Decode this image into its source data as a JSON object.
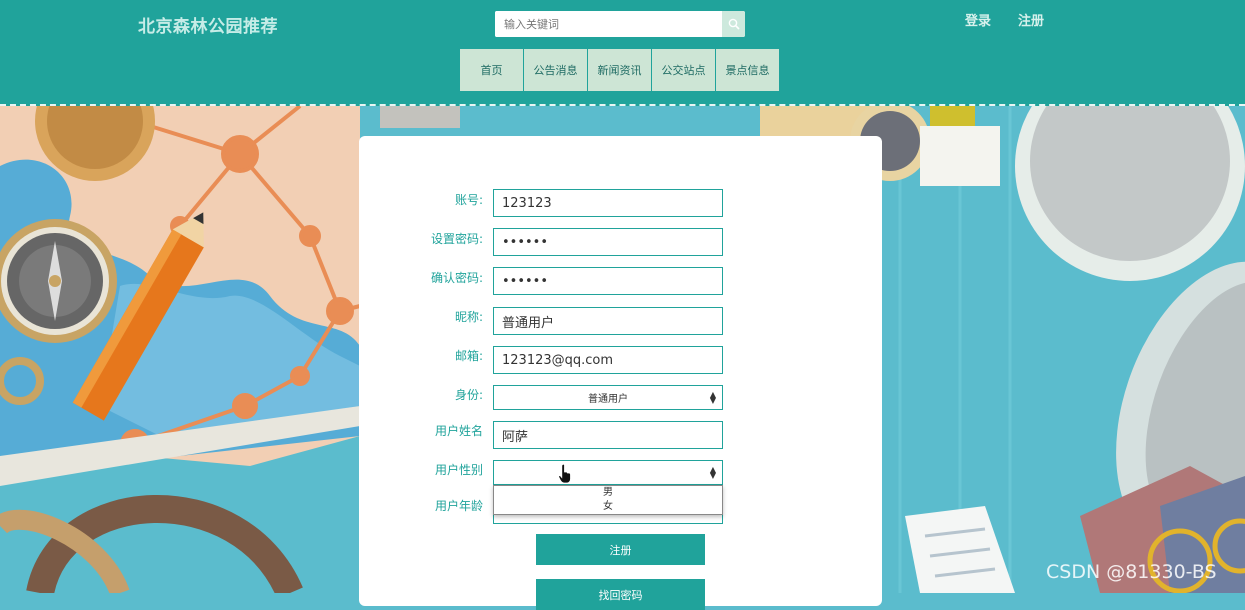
{
  "header": {
    "site_title": "北京森林公园推荐",
    "search": {
      "placeholder": "输入关键词",
      "value": ""
    },
    "login_label": "登录",
    "register_label": "注册",
    "nav": [
      {
        "label": "首页"
      },
      {
        "label": "公告消息"
      },
      {
        "label": "新闻资讯"
      },
      {
        "label": "公交站点"
      },
      {
        "label": "景点信息"
      }
    ]
  },
  "form": {
    "account": {
      "label": "账号:",
      "value": "123123"
    },
    "password": {
      "label": "设置密码:",
      "value": "••••••"
    },
    "confirm_password": {
      "label": "确认密码:",
      "value": "••••••"
    },
    "nickname": {
      "label": "昵称:",
      "value": "普通用户"
    },
    "email": {
      "label": "邮箱:",
      "value": "123123@qq.com"
    },
    "identity": {
      "label": "身份:",
      "value": "普通用户"
    },
    "real_name": {
      "label": "用户姓名",
      "value": "阿萨"
    },
    "gender": {
      "label": "用户性别",
      "value": "",
      "options": [
        "男",
        "女"
      ]
    },
    "age": {
      "label": "用户年龄",
      "value": ""
    },
    "submit_label": "注册",
    "recover_label": "找回密码"
  },
  "watermark": "CSDN @81330-BS",
  "colors": {
    "primary": "#20a39b",
    "nav_bg": "#cde5d5"
  }
}
